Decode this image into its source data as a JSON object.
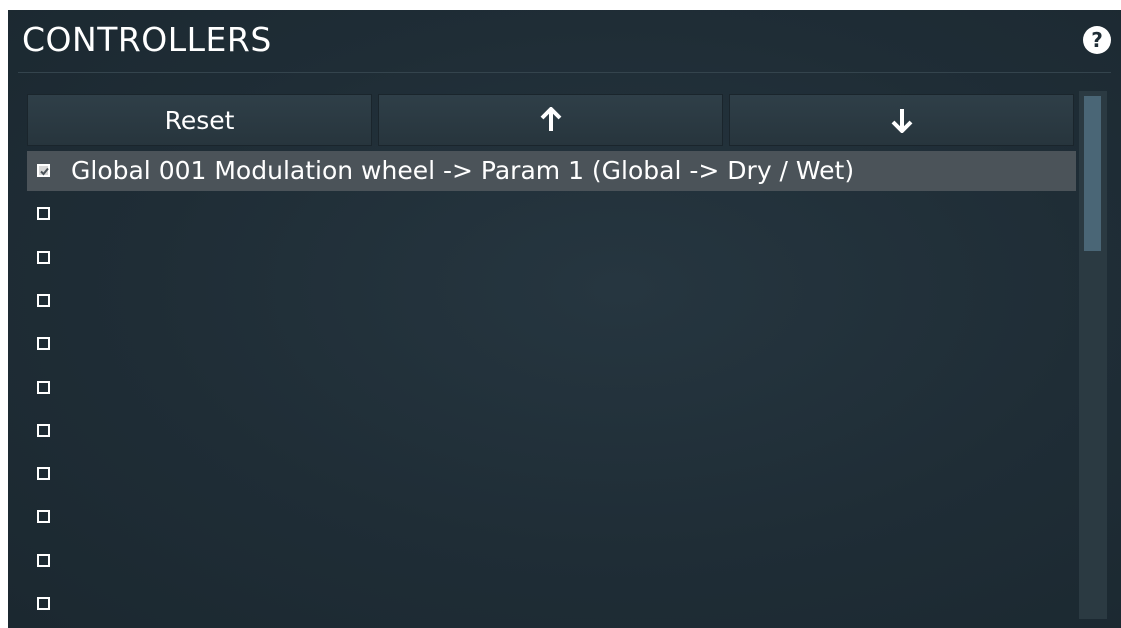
{
  "header": {
    "title": "CONTROLLERS",
    "help_icon": "question-mark-icon",
    "help_label": "?"
  },
  "toolbar": {
    "reset_label": "Reset",
    "up_icon": "arrow-up-icon",
    "down_icon": "arrow-down-icon"
  },
  "list": {
    "items": [
      {
        "checked": true,
        "label": "Global 001 Modulation wheel -> Param 1 (Global -> Dry / Wet)"
      },
      {
        "checked": false,
        "label": ""
      },
      {
        "checked": false,
        "label": ""
      },
      {
        "checked": false,
        "label": ""
      },
      {
        "checked": false,
        "label": ""
      },
      {
        "checked": false,
        "label": ""
      },
      {
        "checked": false,
        "label": ""
      },
      {
        "checked": false,
        "label": ""
      },
      {
        "checked": false,
        "label": ""
      },
      {
        "checked": false,
        "label": ""
      },
      {
        "checked": false,
        "label": ""
      }
    ]
  },
  "colors": {
    "panel_bg": "#1f2d36",
    "button_bg": "#2f3f48",
    "selected_row": "#4b5359",
    "scroll_thumb": "#4a6676",
    "text": "#ffffff"
  }
}
